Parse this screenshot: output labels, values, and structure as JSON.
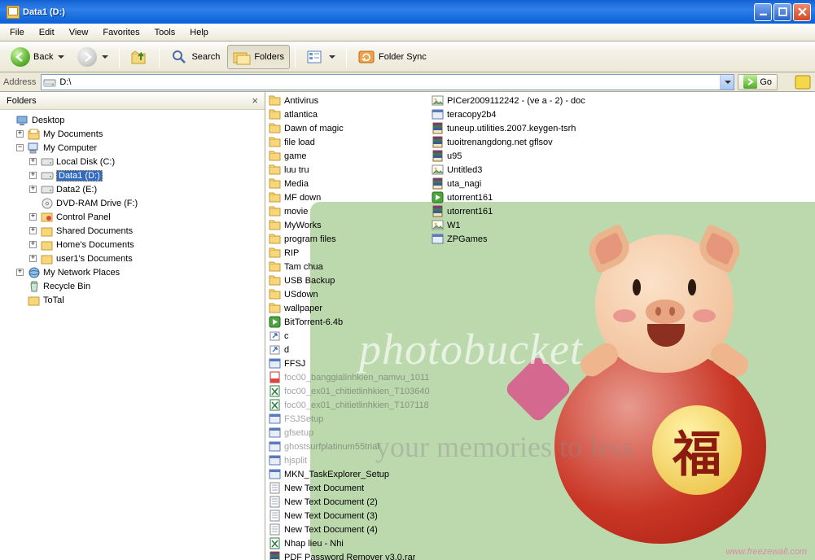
{
  "window": {
    "title": "Data1 (D:)"
  },
  "menu": [
    "File",
    "Edit",
    "View",
    "Favorites",
    "Tools",
    "Help"
  ],
  "toolbar": {
    "back": "Back",
    "search": "Search",
    "folders": "Folders",
    "foldersync": "Folder Sync"
  },
  "address": {
    "label": "Address",
    "value": "D:\\",
    "go": "Go"
  },
  "folders_panel": {
    "title": "Folders"
  },
  "tree": {
    "desktop": "Desktop",
    "mydocs": "My Documents",
    "mycomp": "My Computer",
    "localc": "Local Disk (C:)",
    "data1": "Data1 (D:)",
    "data2": "Data2 (E:)",
    "dvd": "DVD-RAM Drive (F:)",
    "cpanel": "Control Panel",
    "shared": "Shared Documents",
    "homes": "Home's Documents",
    "user1": "user1's Documents",
    "netplaces": "My Network Places",
    "recycle": "Recycle Bin",
    "total": "ToTal"
  },
  "files_col1": [
    {
      "n": "Antivirus",
      "t": "folder"
    },
    {
      "n": "atlantica",
      "t": "folder"
    },
    {
      "n": "Dawn of magic",
      "t": "folder"
    },
    {
      "n": "file load",
      "t": "folder"
    },
    {
      "n": "game",
      "t": "folder"
    },
    {
      "n": "luu tru",
      "t": "folder"
    },
    {
      "n": "Media",
      "t": "folder"
    },
    {
      "n": "MF down",
      "t": "folder"
    },
    {
      "n": "movie",
      "t": "folder"
    },
    {
      "n": "MyWorks",
      "t": "folder"
    },
    {
      "n": "program files",
      "t": "folder"
    },
    {
      "n": "RIP",
      "t": "folder"
    },
    {
      "n": "Tam chua",
      "t": "folder"
    },
    {
      "n": "USB Backup",
      "t": "folder"
    },
    {
      "n": "USdown",
      "t": "folder"
    },
    {
      "n": "wallpaper",
      "t": "folder"
    },
    {
      "n": "BitTorrent-6.4b",
      "t": "app-green"
    },
    {
      "n": "c",
      "t": "shortcut"
    },
    {
      "n": "d",
      "t": "shortcut"
    },
    {
      "n": "FFSJ",
      "t": "app"
    },
    {
      "n": "foc00_banggialinhkien_namvu_1011",
      "t": "pdf",
      "ghost": true
    },
    {
      "n": "foc00_ex01_chitietlinhkien_T103640",
      "t": "xls",
      "ghost": true
    },
    {
      "n": "foc00_ex01_chitietlinhkien_T107118",
      "t": "xls",
      "ghost": true
    },
    {
      "n": "FSJSetup",
      "t": "app",
      "ghost": true
    },
    {
      "n": "gfsetup",
      "t": "app",
      "ghost": true
    },
    {
      "n": "ghostsurfplatinum55trial",
      "t": "app",
      "ghost": true
    },
    {
      "n": "hjsplit",
      "t": "app",
      "ghost": true
    },
    {
      "n": "MKN_TaskExplorer_Setup",
      "t": "app"
    },
    {
      "n": "New Text Document",
      "t": "txt"
    },
    {
      "n": "New Text Document (2)",
      "t": "txt"
    },
    {
      "n": "New Text Document (3)",
      "t": "txt"
    },
    {
      "n": "New Text Document (4)",
      "t": "txt"
    },
    {
      "n": "Nhap lieu - Nhi",
      "t": "xls"
    },
    {
      "n": "PDF Password Remover v3.0.rar",
      "t": "rar"
    }
  ],
  "files_col2": [
    {
      "n": "PICer2009112242 - (ve a - 2) - doc",
      "t": "img"
    },
    {
      "n": "teracopy2b4",
      "t": "app"
    },
    {
      "n": "tuneup.utilities.2007.keygen-tsrh",
      "t": "rar"
    },
    {
      "n": "tuoitrenangdong.net gflsov",
      "t": "rar"
    },
    {
      "n": "u95",
      "t": "rar"
    },
    {
      "n": "Untitled3",
      "t": "img"
    },
    {
      "n": "uta_nagi",
      "t": "rar"
    },
    {
      "n": "utorrent161",
      "t": "app-green"
    },
    {
      "n": "utorrent161",
      "t": "rar"
    },
    {
      "n": "W1",
      "t": "img"
    },
    {
      "n": "ZPGames",
      "t": "app"
    }
  ],
  "watermark": {
    "brand": "photobucket",
    "tag": "your memories to less",
    "url": "www.freezewall.com"
  }
}
